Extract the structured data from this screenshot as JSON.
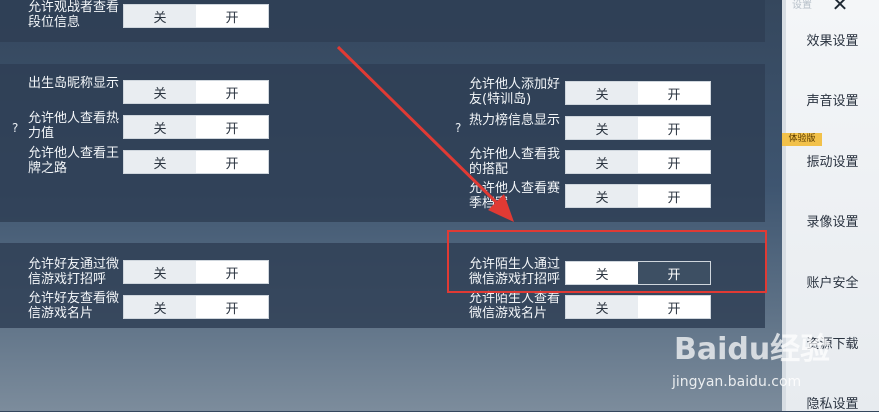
{
  "colors": {
    "highlight": "#e03a34",
    "sidebar_bg": "#f0f2f5",
    "badge": "#f2c14a"
  },
  "toggle": {
    "off_label": "关",
    "on_label": "开"
  },
  "settings": {
    "top": [
      {
        "label": "允许观战者查看段位信息",
        "selected": "on"
      }
    ],
    "mid_left": [
      {
        "label": "出生岛昵称显示",
        "selected": "on"
      },
      {
        "label": "允许他人查看热力值",
        "selected": "on"
      },
      {
        "label": "允许他人查看王牌之路",
        "selected": "on"
      }
    ],
    "mid_right": [
      {
        "label": "允许他人添加好友(特训岛)",
        "selected": "on"
      },
      {
        "label": "热力榜信息显示",
        "selected": "on"
      },
      {
        "label": "允许他人查看我的搭配",
        "selected": "on"
      },
      {
        "label": "允许他人查看赛季档案",
        "selected": "on"
      }
    ],
    "bot_left": [
      {
        "label": "允许好友通过微信游戏打招呼",
        "selected": "on"
      },
      {
        "label": "允许好友查看微信游戏名片",
        "selected": "on"
      }
    ],
    "bot_right": [
      {
        "label": "允许陌生人通过微信游戏打招呼",
        "selected": "off"
      },
      {
        "label": "允许陌生人查看微信游戏名片",
        "selected": "on"
      }
    ]
  },
  "help_mark": "?",
  "sidebar": {
    "top_label": "设置",
    "close": "✕",
    "badge": "体验版",
    "items": [
      "效果设置",
      "声音设置",
      "振动设置",
      "录像设置",
      "账户安全",
      "资源下载",
      "隐私设置"
    ]
  },
  "watermark": {
    "logo": "Baidu经验",
    "url": "jingyan.baidu.com"
  }
}
